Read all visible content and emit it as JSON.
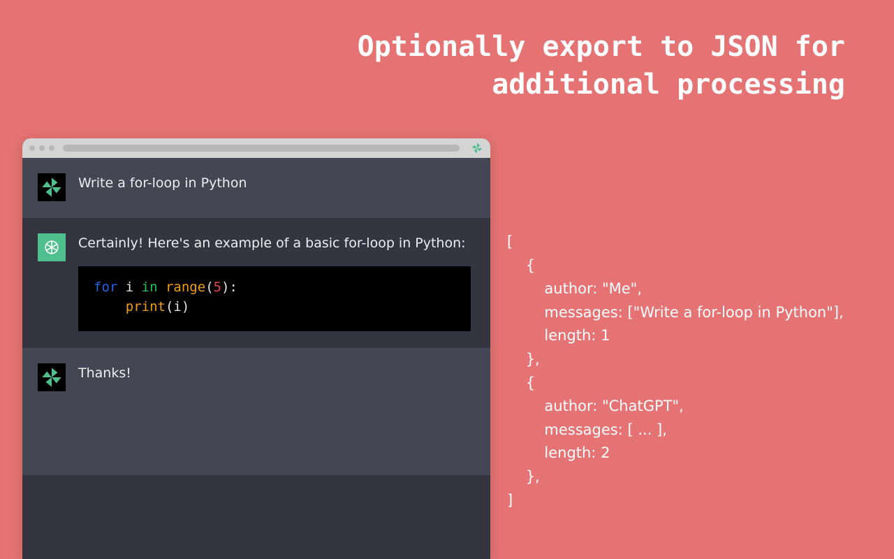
{
  "headline": "Optionally export to JSON for\nadditional processing",
  "chat": {
    "messages": [
      {
        "role": "user",
        "text": "Write a for-loop in Python"
      },
      {
        "role": "assistant",
        "text": "Certainly! Here's an example of a basic for-loop in Python:",
        "code": {
          "line1_kw_for": "for",
          "line1_var_i": " i ",
          "line1_kw_in": "in",
          "line1_fn_range": " range",
          "line1_paren_open": "(",
          "line1_num": "5",
          "line1_paren_close_colon": "):",
          "line2_indent": "    ",
          "line2_fn_print": "print",
          "line2_paren_open": "(",
          "line2_var_i": "i",
          "line2_paren_close": ")"
        }
      },
      {
        "role": "user",
        "text": "Thanks!"
      }
    ]
  },
  "export": {
    "l0": "[",
    "l1": "    {",
    "l2": "        author: \"Me\",",
    "l3": "        messages: [\"Write a for-loop in Python\"],",
    "l4": "        length: 1",
    "l5": "    },",
    "l6": "    {",
    "l7": "        author: \"ChatGPT\",",
    "l8": "        messages: [ ... ],",
    "l9": "        length: 2",
    "l10": "    },",
    "l11": "]"
  }
}
